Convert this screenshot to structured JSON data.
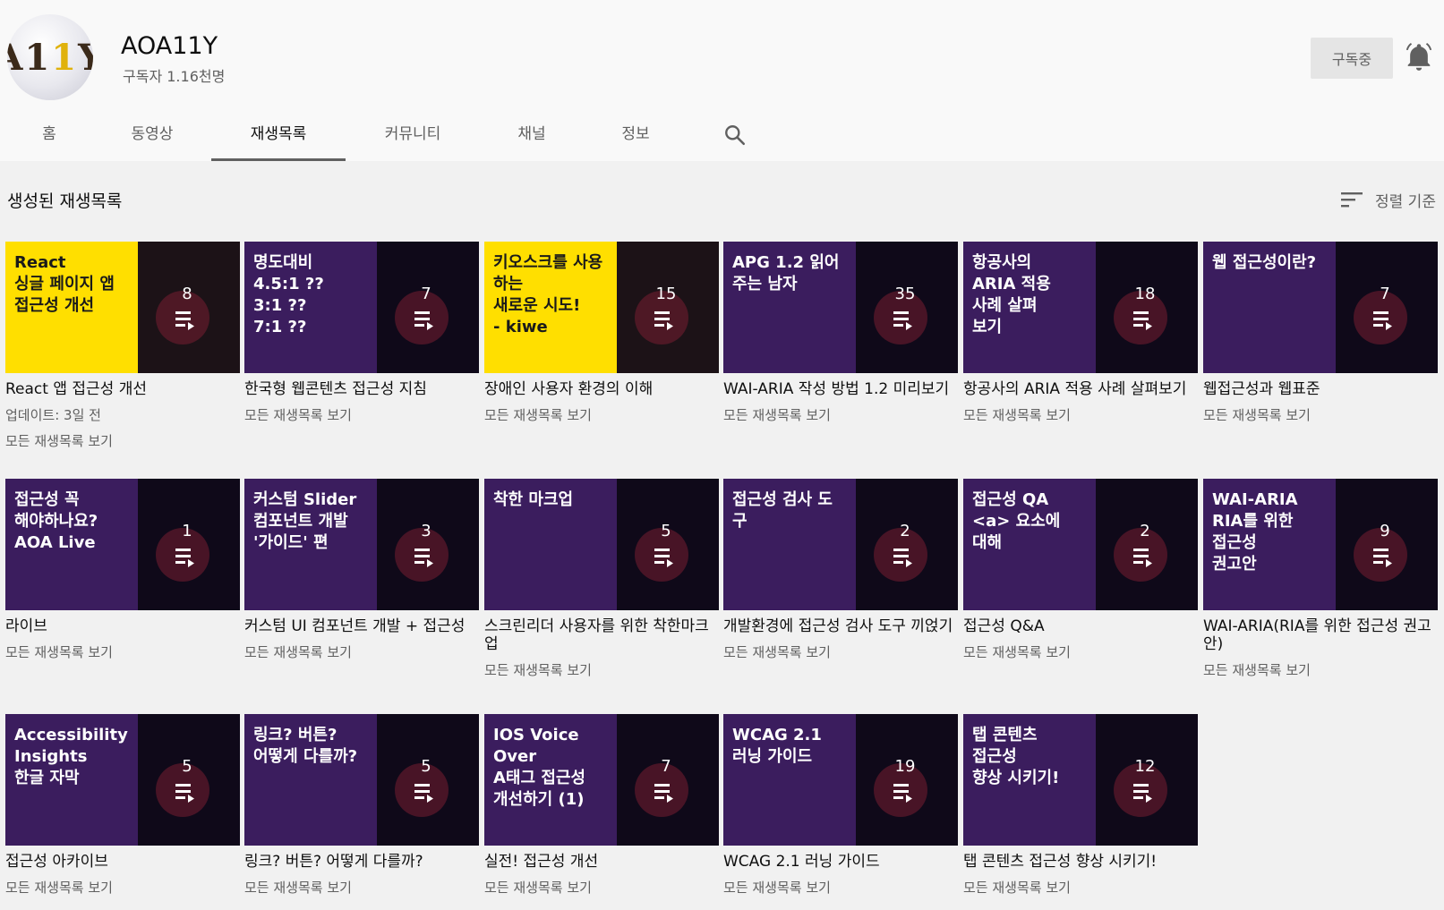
{
  "channel": {
    "avatar_text": [
      "A",
      "1",
      "1",
      "Y"
    ],
    "name": "AOA11Y",
    "subscribers": "구독자 1.16천명",
    "subscribed_label": "구독중"
  },
  "tabs": [
    {
      "label": "홈"
    },
    {
      "label": "동영상"
    },
    {
      "label": "재생목록",
      "active": true
    },
    {
      "label": "커뮤니티"
    },
    {
      "label": "채널"
    },
    {
      "label": "정보"
    }
  ],
  "section": {
    "title": "생성된 재생목록",
    "sort_label": "정렬 기준"
  },
  "colors": {
    "thumb_purple": "#3b1d5e",
    "thumb_yellow": "#ffdf00",
    "overlay_dark": "#0b0810",
    "background": "#f1f1f1",
    "header": "#f9f9f9",
    "accent_pink": "#e6336b"
  },
  "playlists": [
    {
      "thumb_text": "React\n싱글 페이지 앱\n접근성 개선",
      "style": "yellow",
      "count": "8",
      "title": "React 앱 접근성 개선",
      "meta": "업데이트: 3일 전",
      "link": "모든 재생목록 보기"
    },
    {
      "thumb_text": "명도대비\n4.5:1 ??\n3:1 ??\n7:1 ??",
      "style": "purple",
      "count": "7",
      "title": "한국형 웹콘텐츠 접근성 지침",
      "link": "모든 재생목록 보기"
    },
    {
      "thumb_text": "키오스크를 사용하는\n새로운 시도!\n- kiwe",
      "style": "yellow",
      "count": "15",
      "title": "장애인 사용자 환경의 이해",
      "link": "모든 재생목록 보기"
    },
    {
      "thumb_text": "APG 1.2 읽어주는 남자",
      "style": "purple",
      "count": "35",
      "title": "WAI-ARIA 작성 방법 1.2 미리보기",
      "link": "모든 재생목록 보기"
    },
    {
      "thumb_text": "항공사의\nARIA 적용\n사례 살펴\n보기",
      "style": "purple",
      "count": "18",
      "title": "항공사의 ARIA 적용 사례 살펴보기",
      "link": "모든 재생목록 보기"
    },
    {
      "thumb_text": "웹 접근성이란?",
      "style": "purple",
      "count": "7",
      "title": "웹접근성과 웹표준",
      "link": "모든 재생목록 보기"
    },
    {
      "thumb_text": "접근성 꼭\n해야하나요?\nAOA Live",
      "style": "purple",
      "count": "1",
      "title": "라이브",
      "link": "모든 재생목록 보기"
    },
    {
      "thumb_text": "커스텀 Slider\n컴포넌트 개발\n'가이드' 편",
      "style": "purple",
      "count": "3",
      "title": "커스텀 UI 컴포넌트 개발 + 접근성",
      "link": "모든 재생목록 보기"
    },
    {
      "thumb_text": "착한 마크업",
      "style": "purple",
      "count": "5",
      "title": "스크린리더 사용자를 위한 착한마크업",
      "link": "모든 재생목록 보기"
    },
    {
      "thumb_text": "접근성 검사 도구",
      "style": "purple",
      "count": "2",
      "title": "개발환경에 접근성 검사 도구 끼얹기",
      "link": "모든 재생목록 보기"
    },
    {
      "thumb_text": "접근성 QA\n<a> 요소에\n대해",
      "style": "purple",
      "count": "2",
      "title": "접근성 Q&A",
      "link": "모든 재생목록 보기"
    },
    {
      "thumb_text": "WAI-ARIA\nRIA를 위한\n접근성\n권고안",
      "style": "purple",
      "count": "9",
      "title": "WAI-ARIA(RIA를 위한 접근성 권고안)",
      "link": "모든 재생목록 보기"
    },
    {
      "thumb_text": "Accessibility\nInsights\n한글 자막",
      "style": "purple",
      "count": "5",
      "title": "접근성 아카이브",
      "link": "모든 재생목록 보기"
    },
    {
      "thumb_text": "링크? 버튼?\n어떻게 다를까?",
      "style": "purple",
      "count": "5",
      "title": "링크? 버튼? 어떻게 다를까?",
      "link": "모든 재생목록 보기"
    },
    {
      "thumb_text": "IOS Voice Over\nA태그 접근성\n개선하기 (1)",
      "style": "purple",
      "count": "7",
      "title": "실전! 접근성 개선",
      "link": "모든 재생목록 보기"
    },
    {
      "thumb_text": "WCAG 2.1\n러닝 가이드",
      "style": "purple",
      "count": "19",
      "title": "WCAG 2.1 러닝 가이드",
      "link": "모든 재생목록 보기"
    },
    {
      "thumb_text": "탭 콘텐츠\n접근성\n향상 시키기!",
      "style": "purple",
      "count": "12",
      "title": "탭 콘텐츠 접근성 향상 시키기!",
      "link": "모든 재생목록 보기"
    }
  ]
}
